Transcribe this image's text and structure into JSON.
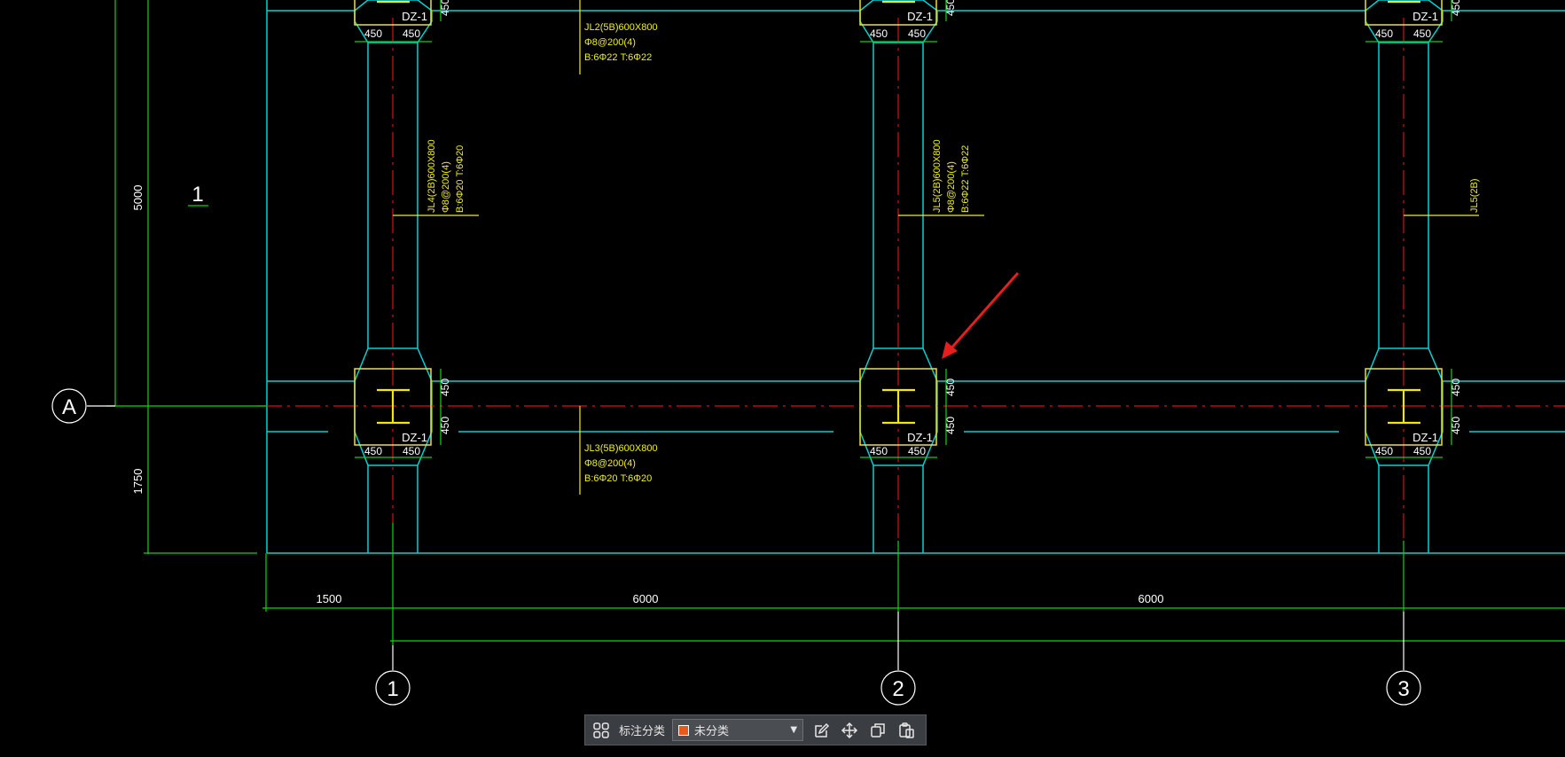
{
  "colors": {
    "background": "#000000",
    "beam_outline": "#00d2d2",
    "axis_line": "#d21414",
    "dimension": "#14d214",
    "annotation": "#f0f014",
    "column": "#f0e614",
    "leader": "#ffffff",
    "arrow": "#e61e1e",
    "category_swatch": "#e65a1e"
  },
  "drawing": {
    "grid_labels": {
      "row_a": "A",
      "col_1": "1",
      "col_2": "2",
      "col_3": "3"
    },
    "section_mark": "1",
    "column_tag": "DZ-1",
    "dim_450": "450",
    "dims_bottom": {
      "d1500": "1500",
      "d6000a": "6000",
      "d6000b": "6000"
    },
    "dims_left": {
      "d5000": "5000",
      "d1750": "1750"
    },
    "beam_jl2": [
      "JL2(5B)600X800",
      "Φ8@200(4)",
      "B:6Φ22  T:6Φ22"
    ],
    "beam_jl3": [
      "JL3(5B)600X800",
      "Φ8@200(4)",
      "B:6Φ20  T:6Φ20"
    ],
    "beam_jl4": [
      "JL4(2B)600X800",
      "Φ8@200(4)",
      "B:6Φ20  T:6Φ20"
    ],
    "beam_jl5": [
      "JL5(2B)600X800",
      "Φ8@200(4)",
      "B:6Φ22  T:6Φ22"
    ],
    "beam_jl5_short": "JL5(2B)"
  },
  "toolbar": {
    "grid_icon": "grid-icon",
    "category_label": "标注分类",
    "category_value": "未分类",
    "edit_icon": "edit-icon",
    "move_icon": "move-icon",
    "copy_icon": "copy-icon",
    "paste_icon": "paste-icon"
  }
}
